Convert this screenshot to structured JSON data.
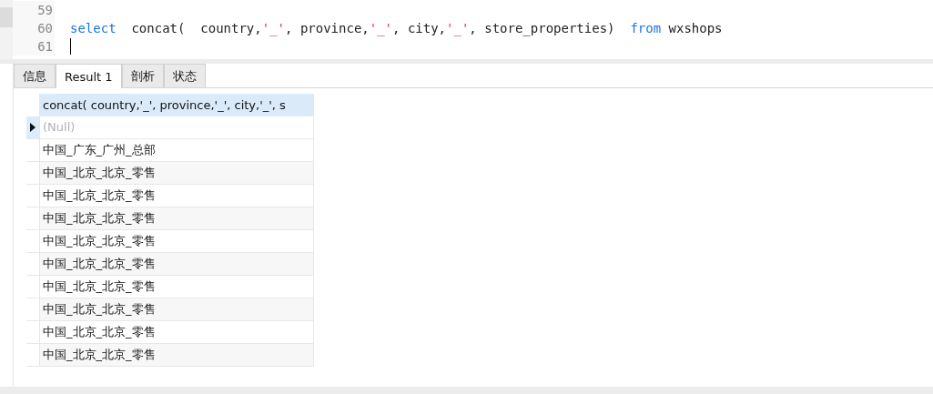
{
  "editor": {
    "lines": [
      {
        "number": "59"
      },
      {
        "number": "60",
        "tokens": [
          {
            "kind": "keyword",
            "text": "select"
          },
          {
            "kind": "plain",
            "text": "  concat(  country,"
          },
          {
            "kind": "string",
            "text": "'_'"
          },
          {
            "kind": "plain",
            "text": ", province,"
          },
          {
            "kind": "string",
            "text": "'_'"
          },
          {
            "kind": "plain",
            "text": ", city,"
          },
          {
            "kind": "string",
            "text": "'_'"
          },
          {
            "kind": "plain",
            "text": ", store_properties)  "
          },
          {
            "kind": "keyword",
            "text": "from"
          },
          {
            "kind": "plain",
            "text": " wxshops"
          }
        ]
      },
      {
        "number": "61",
        "cursor": true
      }
    ]
  },
  "tabs": [
    {
      "label": "信息",
      "selected": false
    },
    {
      "label": "Result 1",
      "selected": true
    },
    {
      "label": "剖析",
      "selected": false
    },
    {
      "label": "状态",
      "selected": false
    }
  ],
  "table": {
    "columns": [
      "concat(  country,'_', province,'_', city,'_', s"
    ],
    "rows": [
      {
        "kind": "null",
        "value": "(Null)",
        "selected": true
      },
      {
        "kind": "text",
        "value": "中国_广东_广州_总部",
        "selected": false
      },
      {
        "kind": "text",
        "value": "中国_北京_北京_零售",
        "selected": false
      },
      {
        "kind": "text",
        "value": "中国_北京_北京_零售",
        "selected": false
      },
      {
        "kind": "text",
        "value": "中国_北京_北京_零售",
        "selected": false
      },
      {
        "kind": "text",
        "value": "中国_北京_北京_零售",
        "selected": false
      },
      {
        "kind": "text",
        "value": "中国_北京_北京_零售",
        "selected": false
      },
      {
        "kind": "text",
        "value": "中国_北京_北京_零售",
        "selected": false
      },
      {
        "kind": "text",
        "value": "中国_北京_北京_零售",
        "selected": false
      },
      {
        "kind": "text",
        "value": "中国_北京_北京_零售",
        "selected": false
      },
      {
        "kind": "text",
        "value": "中国_北京_北京_零售",
        "selected": false
      }
    ]
  }
}
